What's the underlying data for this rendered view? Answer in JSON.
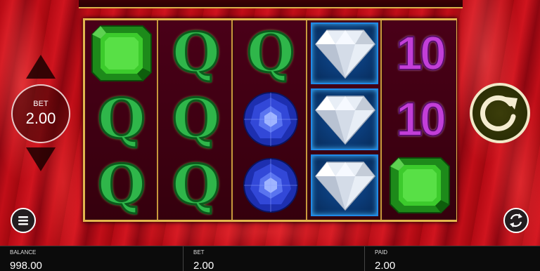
{
  "controls": {
    "bet_label": "BET",
    "bet_value": "2.00"
  },
  "reels": [
    [
      "emerald",
      "Q",
      "Q"
    ],
    [
      "Q",
      "Q",
      "Q"
    ],
    [
      "Q",
      "sapphire",
      "sapphire"
    ],
    [
      "diamond",
      "diamond",
      "diamond"
    ],
    [
      "10",
      "10",
      "emerald"
    ]
  ],
  "symbol_text": {
    "q": "Q",
    "ten": "10"
  },
  "status_bar": {
    "balance_label": "BALANCE",
    "balance_value": "998.00",
    "bet_label": "BET",
    "bet_value": "2.00",
    "paid_label": "PAID",
    "paid_value": "2.00"
  },
  "icons": {
    "spin": "spin-arrow-icon",
    "menu": "menu-icon",
    "autoplay": "autoplay-icon",
    "bet_up": "arrow-up-icon",
    "bet_down": "arrow-down-icon"
  },
  "colors": {
    "frame_gold": "#e2b64e",
    "curtain_red": "#c20e18",
    "q_green": "#2fb64a",
    "ten_purple": "#c23ed8",
    "diamond_blue": "#1f8ae6"
  }
}
